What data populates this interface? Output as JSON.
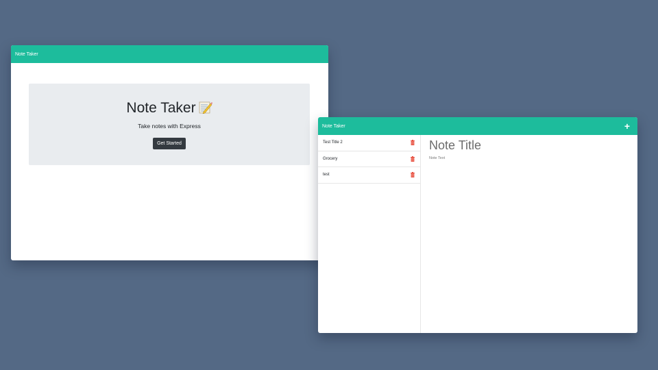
{
  "landing": {
    "brand": "Note Taker",
    "title": "Note Taker",
    "subtitle": "Take notes with Express",
    "button": "Get Started"
  },
  "notes": {
    "brand": "Note Taker",
    "list": [
      {
        "title": "Test Title 2"
      },
      {
        "title": "Grocery"
      },
      {
        "title": "test"
      }
    ],
    "note_title_placeholder": "Note Title",
    "note_text_placeholder": "Note Text"
  },
  "icons": {
    "memo": "memo-emoji-icon",
    "plus": "plus-icon",
    "delete": "trash-icon"
  },
  "colors": {
    "background": "#546985",
    "navbar": "#1dbc9c",
    "jumbotron": "#e9ecef",
    "button": "#343a40",
    "delete_icon": "#e74c3c"
  }
}
